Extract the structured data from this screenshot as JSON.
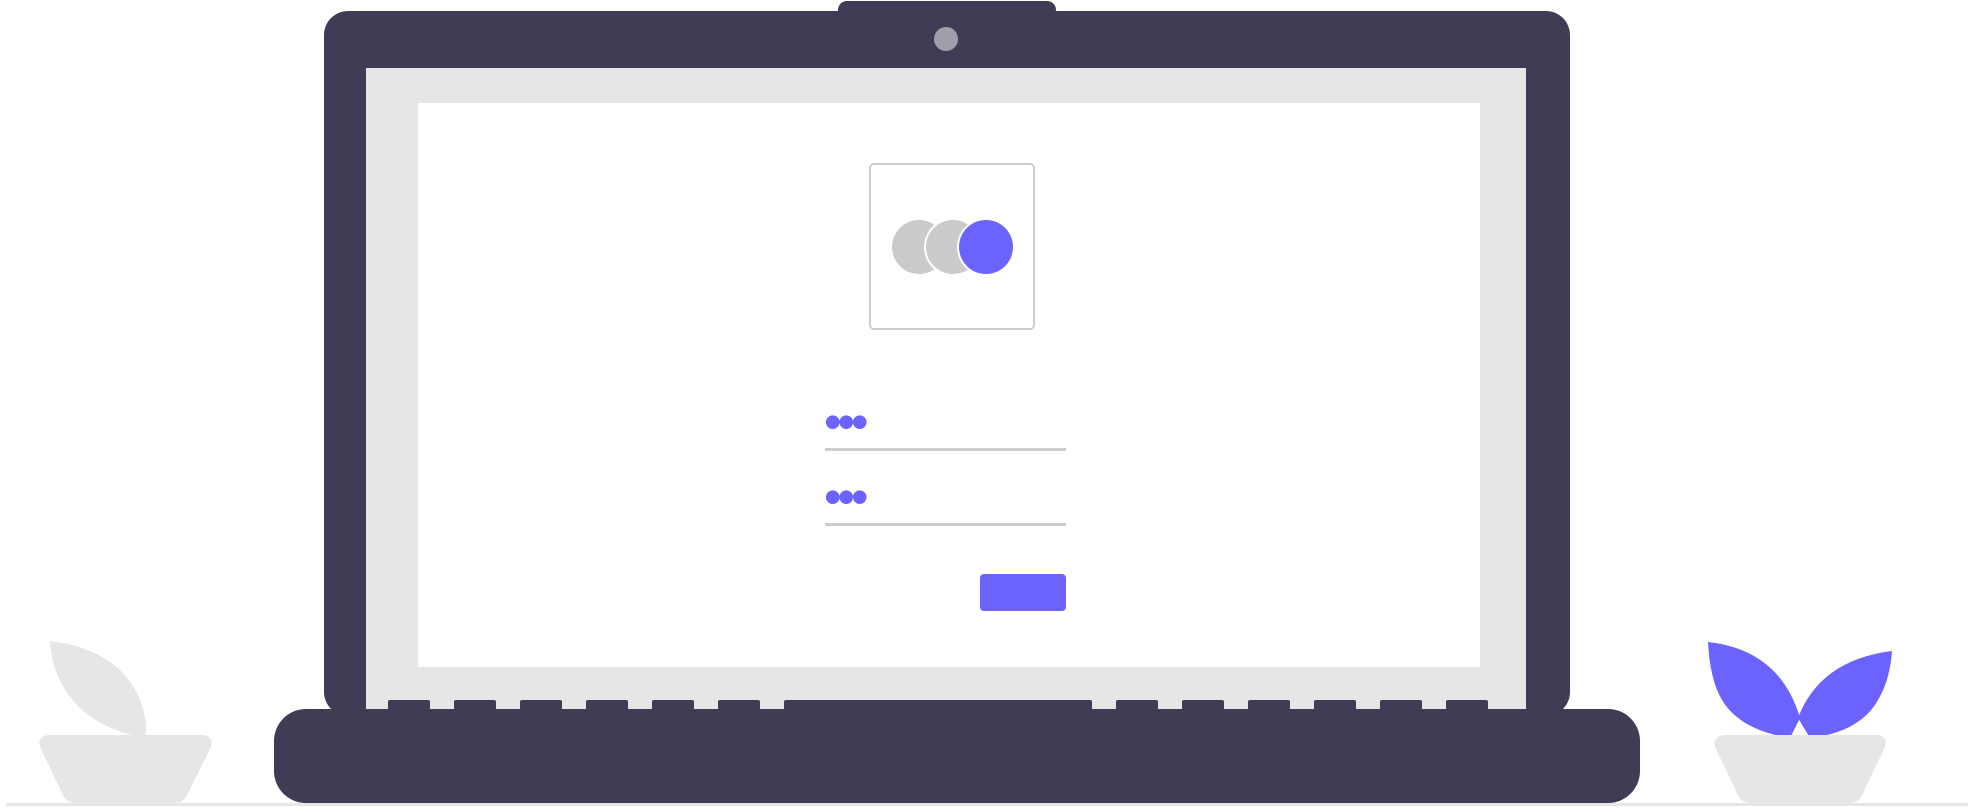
{
  "colors": {
    "laptop_body": "#3f3d56",
    "screen_bezel_inner": "#e6e6e6",
    "screen_content": "#ffffff",
    "accent": "#6c63ff",
    "avatar_inactive": "#cbcbcb",
    "card_border": "#cccccc",
    "plant_pot": "#e6e6e6",
    "ground_line": "#e6e6e6"
  },
  "login_form": {
    "username_mask": "•••",
    "password_mask": "•••",
    "submit_label": ""
  },
  "icons": {
    "webcam": "webcam-icon",
    "avatar_group": "avatar-group-icon",
    "plant_left": "plant-icon",
    "plant_right": "plant-icon"
  }
}
